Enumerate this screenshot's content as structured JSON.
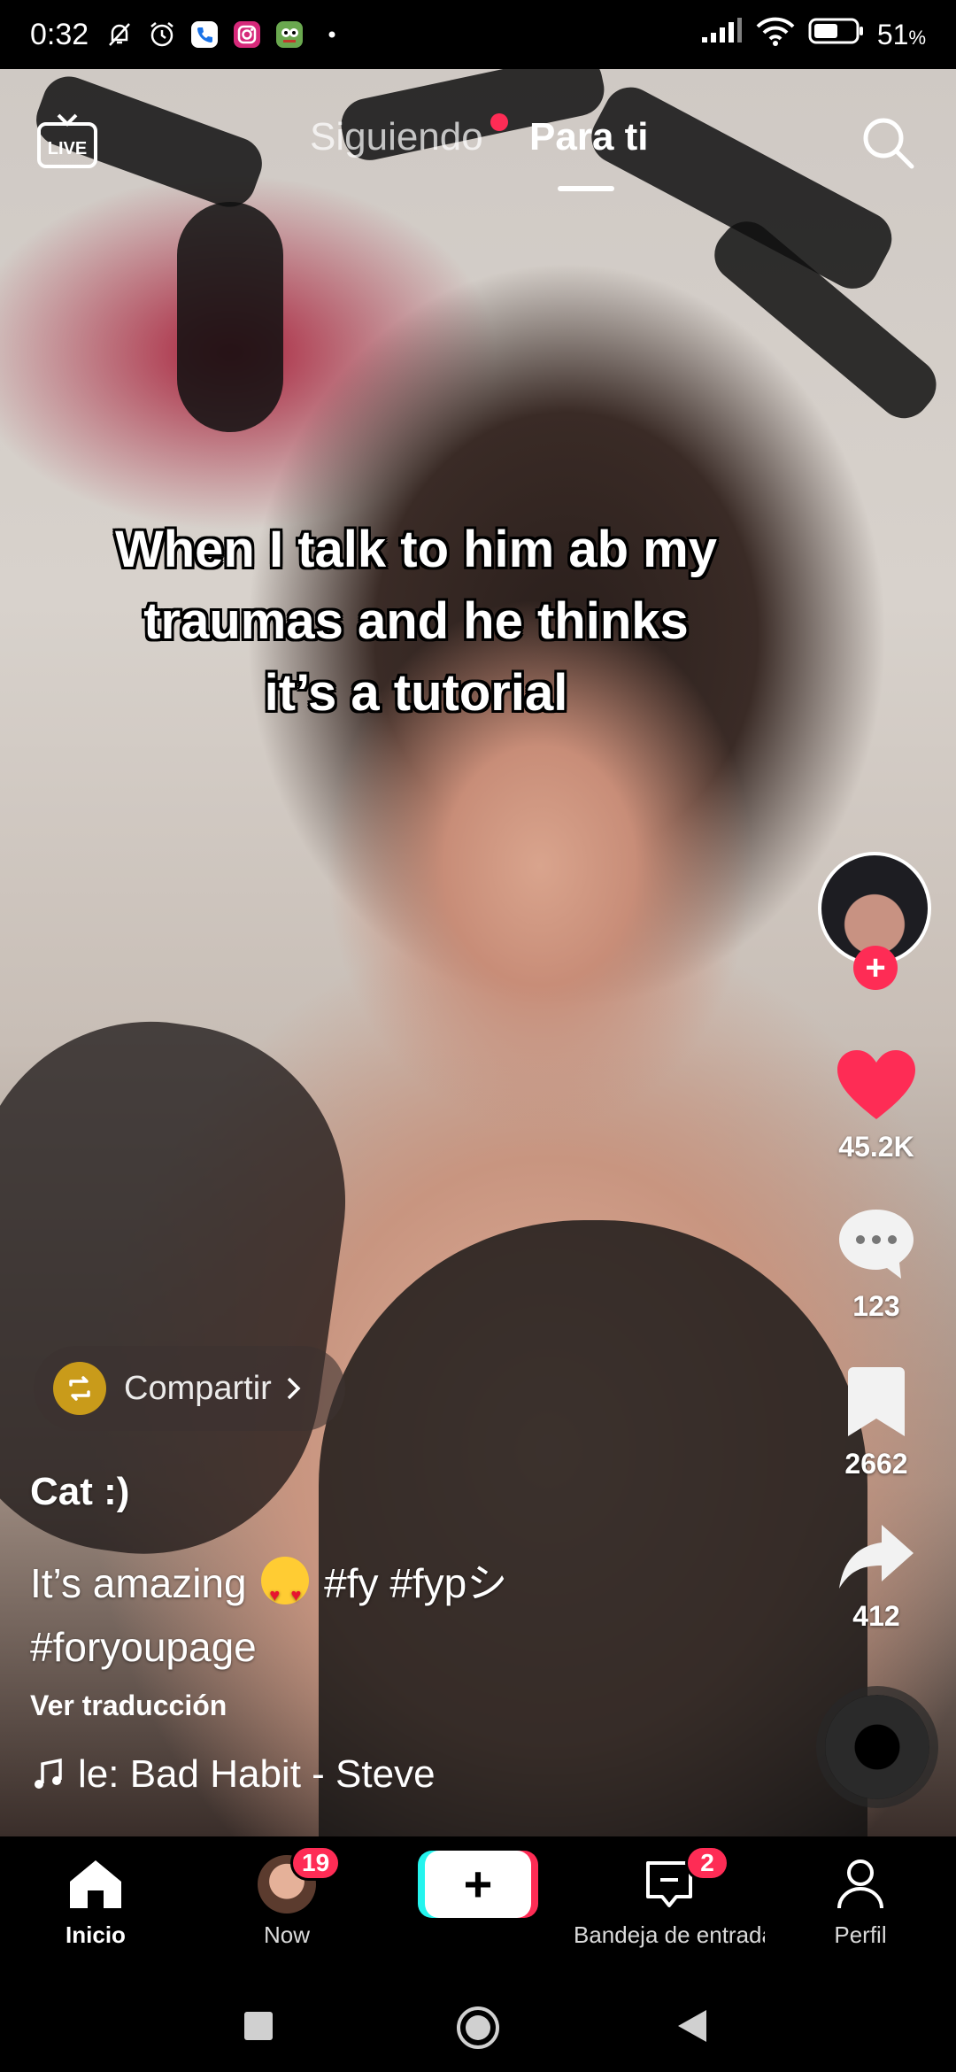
{
  "status_bar": {
    "time": "0:32",
    "battery_percent": "51",
    "battery_unit": "%"
  },
  "top_nav": {
    "following_label": "Siguiendo",
    "for_you_label": "Para ti",
    "live_label": "LIVE"
  },
  "video": {
    "overlay_caption": "When I talk to him ab my\ntraumas and he thinks\nit’s a tutorial"
  },
  "actions": {
    "likes": "45.2K",
    "comments": "123",
    "saves": "2662",
    "shares": "412"
  },
  "share_prompt": {
    "label": "Compartir"
  },
  "post": {
    "author": "Cat :)",
    "description_text": "It’s amazing",
    "hashtags_line1": "#fy #fypシ",
    "hashtags_line2": "#foryoupage",
    "translate_label": "Ver traducción",
    "sound": "le: Bad Habit - Steve"
  },
  "bottom_nav": {
    "home_label": "Inicio",
    "now_label": "Now",
    "now_badge": "19",
    "inbox_label": "Bandeja de entrada",
    "inbox_badge": "2",
    "profile_label": "Perfil"
  },
  "colors": {
    "accent": "#fe2c55",
    "cyan": "#25f4ee",
    "background": "#000000"
  }
}
